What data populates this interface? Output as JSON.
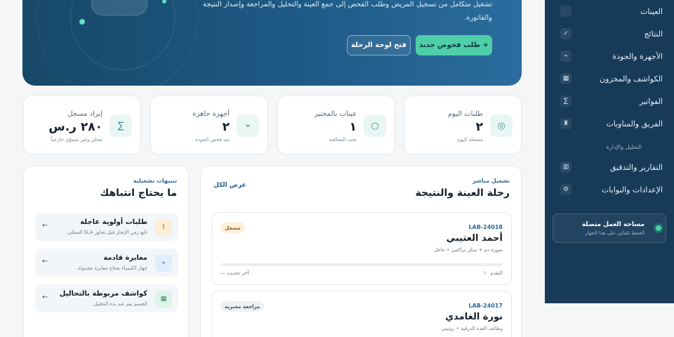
{
  "hero": {
    "description": "تشغيل متكامل من تسجيل المريض وطلب الفحص إلى جمع العينة والتحليل والمراجعة وإصدار النتيجة والفاتورة.",
    "primary_button": "+ طلب فحوص جديد",
    "secondary_button": "فتح لوحة الرحلة"
  },
  "sidebar": {
    "items": [
      {
        "label": "العينات",
        "icon": "flask-icon",
        "glyph": ""
      },
      {
        "label": "النتائج",
        "icon": "check-icon",
        "glyph": "✓"
      },
      {
        "label": "الأجهزة والجودة",
        "icon": "pulse-icon",
        "glyph": "⌁"
      },
      {
        "label": "الكواشف والمخزون",
        "icon": "grid-icon",
        "glyph": "▦"
      },
      {
        "label": "الفواتير",
        "icon": "sigma-icon",
        "glyph": "∑"
      },
      {
        "label": "الفريق والمناوبات",
        "icon": "person-icon",
        "glyph": "♜"
      }
    ],
    "section_label": "التحليل والإدارة",
    "admin_items": [
      {
        "label": "التقارير والتدقيق",
        "icon": "table-icon",
        "glyph": "▥"
      },
      {
        "label": "الإعدادات والبوابات",
        "icon": "settings-icon",
        "glyph": "⚙"
      }
    ],
    "workspace": {
      "title": "مساحة العمل متصلة",
      "subtitle": "الحفظ تلقائي على هذا الجهاز"
    }
  },
  "stats": [
    {
      "label": "طلبات اليوم",
      "value": "٢",
      "sub": "مسجلة اليوم",
      "icon": "target-icon",
      "glyph": "◎"
    },
    {
      "label": "عينات بالمختبر",
      "value": "١",
      "sub": "تحت المعالجة",
      "icon": "drop-icon",
      "glyph": "○"
    },
    {
      "label": "أجهزة جاهزة",
      "value": "٢",
      "sub": "بعد فحص الجودة",
      "icon": "pulse-icon",
      "glyph": "⌁"
    },
    {
      "label": "إيراد مسجل",
      "value": "٢٨٠ ر.س",
      "sub": "محلي وغير مسوّى خارجياً",
      "icon": "sigma-icon",
      "glyph": "∑"
    }
  ],
  "journey": {
    "kicker": "تشغيل مباشر",
    "title": "رحلة العينة والنتيجة",
    "view_all": "عرض الكل",
    "samples": [
      {
        "code": "LAB-24018",
        "name": "أحمد العتيبي",
        "desc": "صورة دم + سكر تراكمي • عاجل",
        "badge": "مسجل",
        "progress_label": "التقدم ٠٪",
        "progress": 0,
        "updated": "آخر تحديث —"
      },
      {
        "code": "LAB-24017",
        "name": "نورة الغامدي",
        "desc": "وظائف الغدة الدرقية • روتيني",
        "badge": "مراجعة مخبرية"
      }
    ]
  },
  "alerts": {
    "kicker": "تنبيهات تشغيلية",
    "title": "ما يحتاج انتباهك",
    "items": [
      {
        "title": "طلبات أولوية عاجلة",
        "desc": "تابع زمن الإنجاز قبل تجاوز SLA المحلي.",
        "icon": "exclamation-icon",
        "glyph": "!"
      },
      {
        "title": "معايرة قادمة",
        "desc": "جهاز الكيمياء يحتاج معايرة مجدولة.",
        "icon": "pulse-icon",
        "glyph": "⌁"
      },
      {
        "title": "كواشف مربوطة بالتحاليل",
        "desc": "الخصم يتم عند بدء التحليل.",
        "icon": "grid-icon",
        "glyph": "▦"
      }
    ]
  },
  "colors": {
    "sidebar": "#173a59",
    "accent": "#4fcfa9",
    "hero": "#1e5a86",
    "link": "#245f8f"
  }
}
